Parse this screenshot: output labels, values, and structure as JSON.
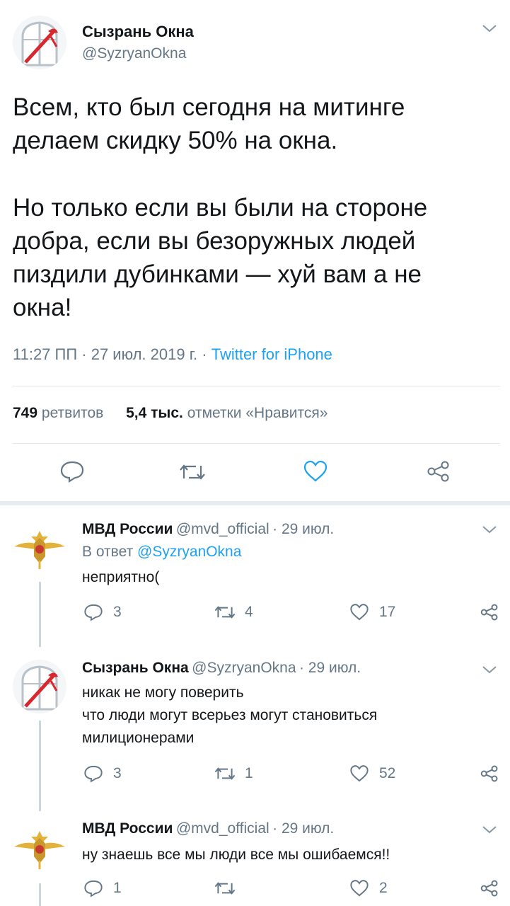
{
  "main_tweet": {
    "author_name": "Сызрань Окна",
    "author_handle": "@SyzryanOkna",
    "text_lines": [
      "Всем, кто был сегодня на митинге",
      "делаем скидку 50% на окна.",
      "Но только если вы были на стороне",
      "добра, если вы безоружных людей",
      "пиздили дубинками — хуй вам а не",
      "окна!"
    ],
    "time": "11:27 ПП · 27 июл. 2019 г. · ",
    "source": "Twitter for iPhone",
    "retweets_count": "749",
    "retweets_label": "ретвитов",
    "likes_count": "5,4 тыс.",
    "likes_label": "отметки «Нравится»"
  },
  "replies": [
    {
      "author_name": "МВД России",
      "author_handle": "@mvd_official",
      "date": "· 29 июл.",
      "reply_to_label": "В ответ",
      "reply_to_handle": "@SyzryanOkna",
      "text_lines": [
        "неприятно("
      ],
      "replies": "3",
      "retweets": "4",
      "likes": "17"
    },
    {
      "author_name": "Сызрань Окна",
      "author_handle": "@SyzryanOkna",
      "date": "· 29 июл.",
      "text_lines": [
        "никак не могу поверить",
        "что люди могут всерьез могут становиться",
        "милиционерами"
      ],
      "replies": "3",
      "retweets": "1",
      "likes": "52"
    },
    {
      "author_name": "МВД России",
      "author_handle": "@mvd_official",
      "date": "· 29 июл.",
      "text_lines": [
        "ну знаешь все мы люди все мы ошибаемся!!"
      ],
      "replies": "1",
      "retweets": "",
      "likes": "2"
    }
  ],
  "colors": {
    "accent": "#1da1f2",
    "secondary_text": "#657786",
    "divider": "#e1e8ed",
    "like_icon": "#1da1f2"
  }
}
